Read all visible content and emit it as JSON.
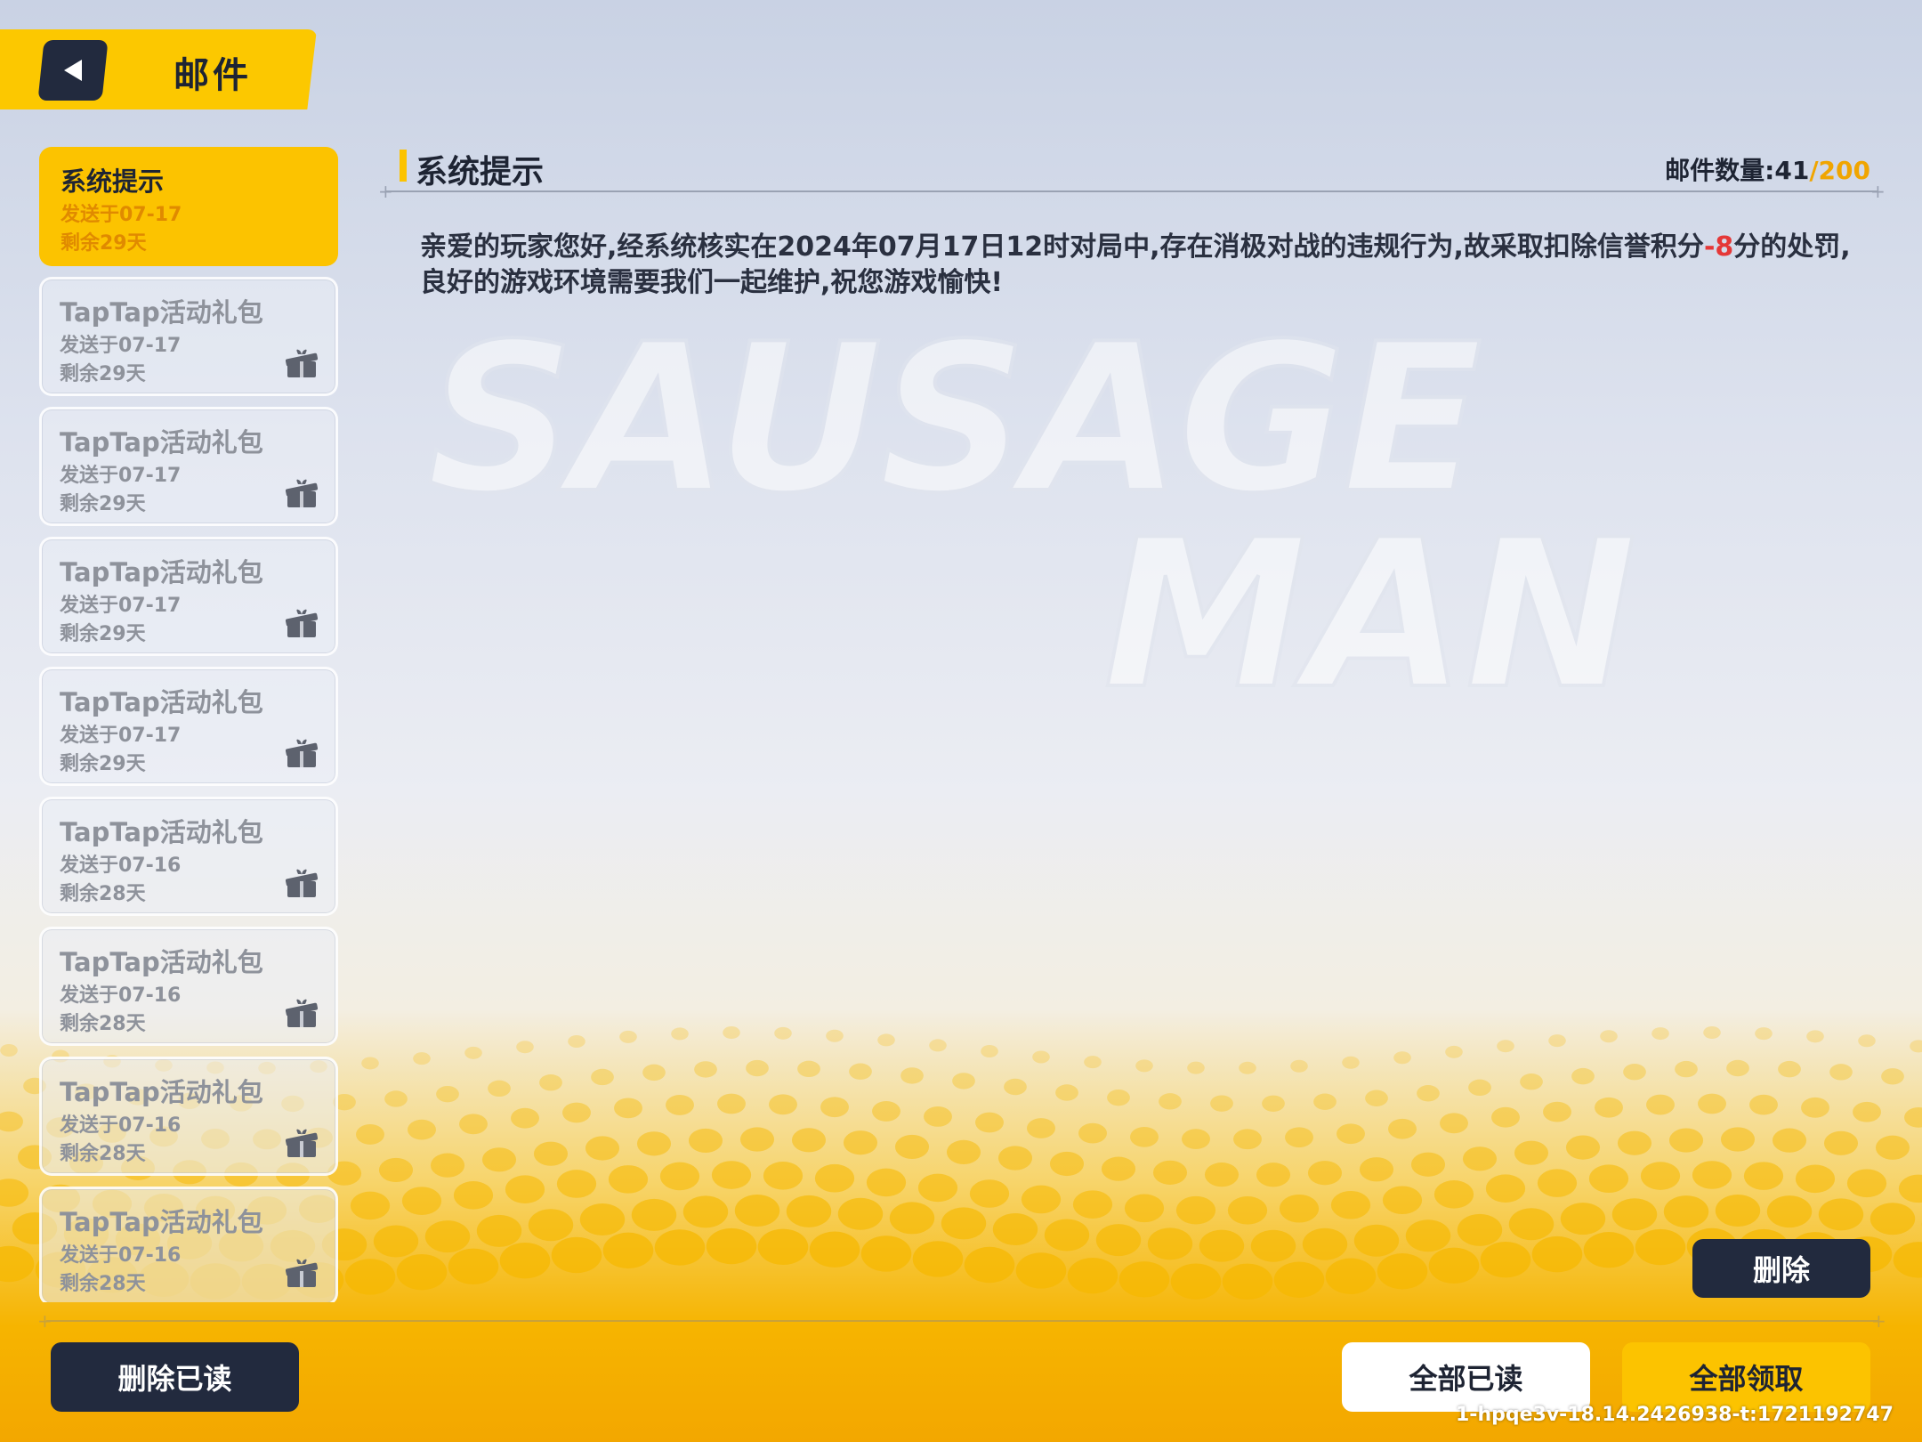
{
  "header": {
    "title": "邮件"
  },
  "mail_list": [
    {
      "title": "系统提示",
      "date": "发送于07-17",
      "remain": "剩余29天",
      "selected": true,
      "has_gift": false
    },
    {
      "title": "TapTap活动礼包",
      "date": "发送于07-17",
      "remain": "剩余29天",
      "selected": false,
      "has_gift": true
    },
    {
      "title": "TapTap活动礼包",
      "date": "发送于07-17",
      "remain": "剩余29天",
      "selected": false,
      "has_gift": true
    },
    {
      "title": "TapTap活动礼包",
      "date": "发送于07-17",
      "remain": "剩余29天",
      "selected": false,
      "has_gift": true
    },
    {
      "title": "TapTap活动礼包",
      "date": "发送于07-17",
      "remain": "剩余29天",
      "selected": false,
      "has_gift": true
    },
    {
      "title": "TapTap活动礼包",
      "date": "发送于07-16",
      "remain": "剩余28天",
      "selected": false,
      "has_gift": true
    },
    {
      "title": "TapTap活动礼包",
      "date": "发送于07-16",
      "remain": "剩余28天",
      "selected": false,
      "has_gift": true
    },
    {
      "title": "TapTap活动礼包",
      "date": "发送于07-16",
      "remain": "剩余28天",
      "selected": false,
      "has_gift": true
    },
    {
      "title": "TapTap活动礼包",
      "date": "发送于07-16",
      "remain": "剩余28天",
      "selected": false,
      "has_gift": true
    }
  ],
  "content": {
    "title": "系统提示",
    "count_label": "邮件数量:",
    "count_current": "41",
    "count_sep_max": "/200",
    "body_pre": "亲爱的玩家您好,经系统核实在2024年07月17日12时对局中,存在消极对战的违规行为,故采取扣除信誉积分",
    "body_value": "-8",
    "body_post": "分的处罚,良好的游戏环境需要我们一起维护,祝您游戏愉快!"
  },
  "buttons": {
    "delete": "删除",
    "delete_read": "删除已读",
    "read_all": "全部已读",
    "claim_all": "全部领取"
  },
  "watermark": {
    "line1": "SAUSAGE",
    "line2": "MAN"
  },
  "version_text": "1-hpqe3v-18.14.2426938-t:1721192747",
  "colors": {
    "accent": "#fcc300",
    "dark": "#222a3e",
    "negative": "#e53838",
    "count_max": "#f0a500"
  }
}
